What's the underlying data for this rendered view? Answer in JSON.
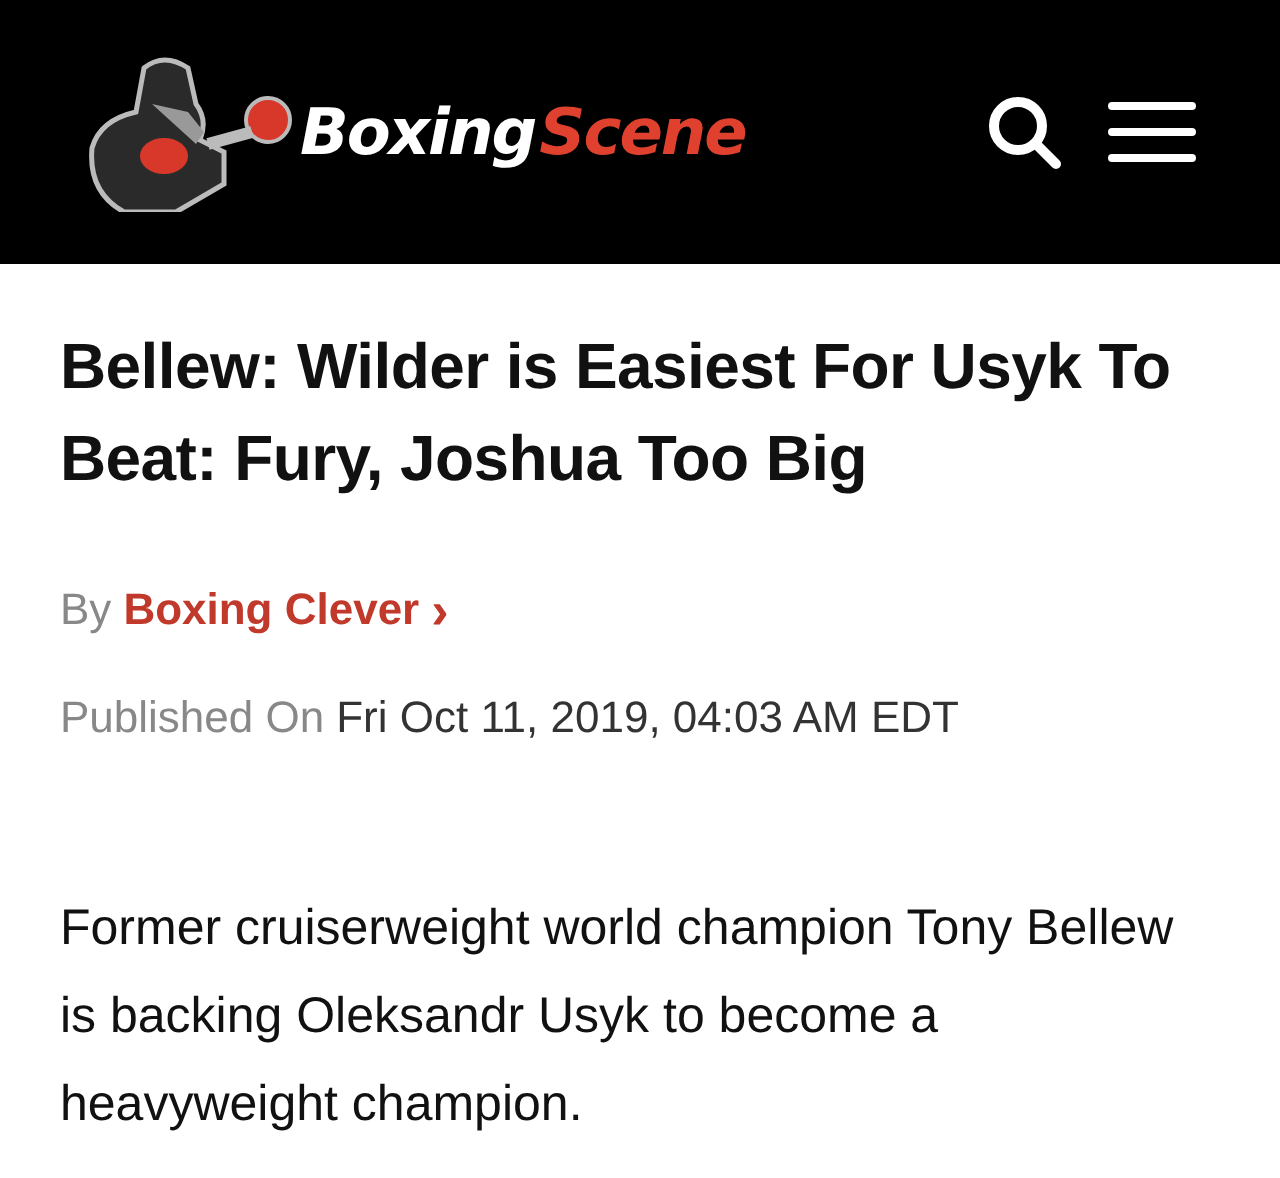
{
  "header": {
    "logo": {
      "first_word": "Boxing",
      "second_word": "Scene"
    }
  },
  "article": {
    "title": "Bellew: Wilder is Easiest For Usyk To Beat: Fury, Joshua Too Big",
    "byline": {
      "prefix": "By",
      "author": "Boxing Clever",
      "chevron": "›"
    },
    "published": {
      "label": "Published On",
      "date": "Fri Oct 11, 2019, 04:03 AM EDT"
    },
    "body": "Former cruiserweight world champion Tony Bellew is backing Oleksandr Usyk to become a heavyweight champion."
  }
}
